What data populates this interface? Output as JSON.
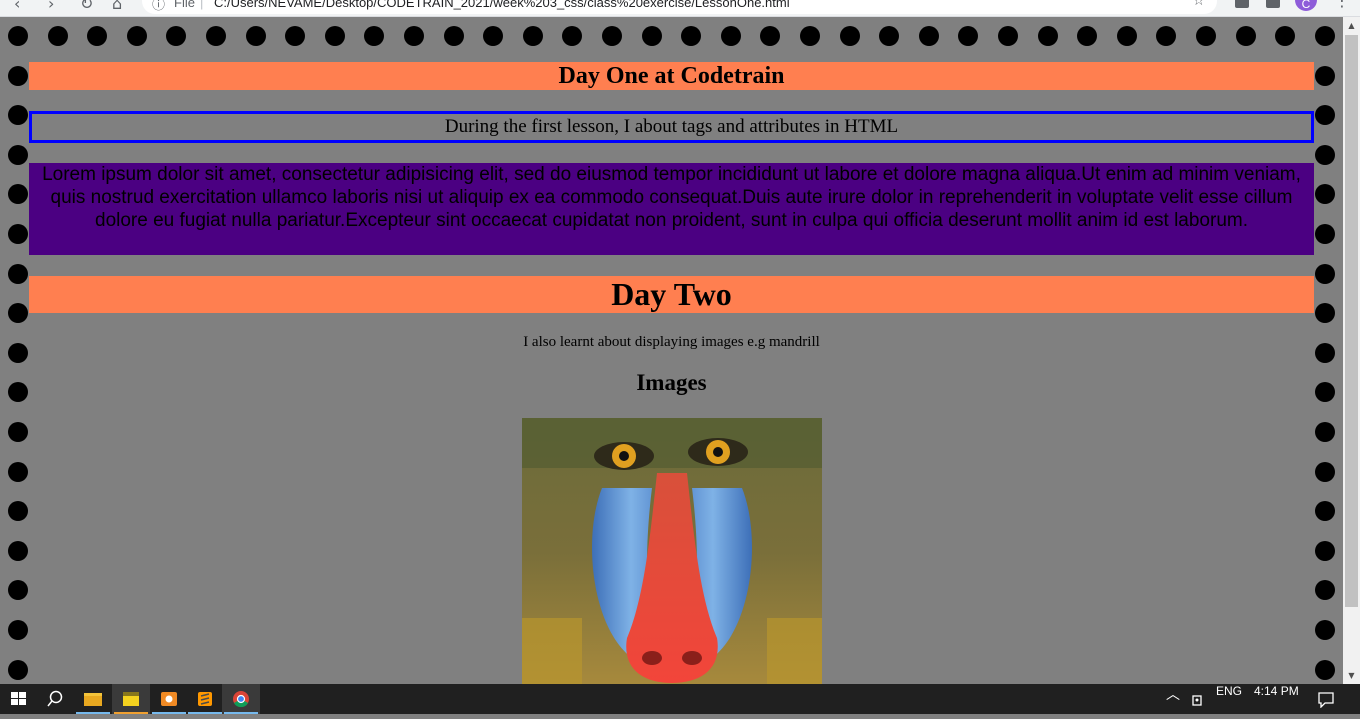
{
  "browser": {
    "scheme_label": "File",
    "separator": "|",
    "url": "C:/Users/NEVAME/Desktop/CODETRAIN_2021/week%203_css/class%20exercise/LessonOne.html",
    "profile_initial": "C"
  },
  "page": {
    "day_one_heading": "Day One at Codetrain",
    "lesson_note": "During the first lesson, I about tags and attributes in HTML",
    "lorem_paragraph": "Lorem ipsum dolor sit amet, consectetur adipisicing elit, sed do eiusmod tempor incididunt ut labore et dolore magna aliqua.Ut enim ad minim veniam, quis nostrud exercitation ullamco laboris nisi ut aliquip ex ea commodo consequat.Duis aute irure dolor in reprehenderit in voluptate velit esse cillum dolore eu fugiat nulla pariatur.Excepteur sint occaecat cupidatat non proident, sunt in culpa qui officia deserunt mollit anim id est laborum.",
    "day_two_heading": "Day Two",
    "images_note": "I also learnt about displaying images e.g mandrill",
    "images_heading": "Images",
    "image_subject": "mandrill"
  },
  "colors": {
    "page_background": "#808080",
    "heading_band": "#ff7f50",
    "lorem_band": "#4b0082",
    "note_border": "#0000ff",
    "border_dots": "#000000"
  },
  "taskbar": {
    "apps": [
      "start-icon",
      "search-icon",
      "file-explorer-icon",
      "sticky-notes-icon",
      "app-icon",
      "sublime-text-icon",
      "chrome-icon"
    ],
    "language": "ENG",
    "time": "4:14 PM"
  }
}
